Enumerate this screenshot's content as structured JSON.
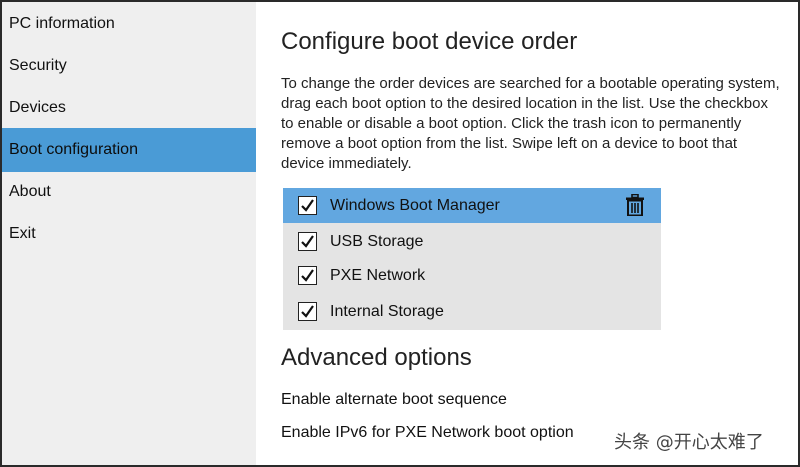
{
  "sidebar": {
    "items": [
      {
        "label": "PC information",
        "active": false
      },
      {
        "label": "Security",
        "active": false
      },
      {
        "label": "Devices",
        "active": false
      },
      {
        "label": "Boot configuration",
        "active": true
      },
      {
        "label": "About",
        "active": false
      },
      {
        "label": "Exit",
        "active": false
      }
    ]
  },
  "main": {
    "title": "Configure boot device order",
    "description": "To change the order devices are searched for a bootable operating system, drag each boot option to the desired location in the list. Use the checkbox to enable or disable a boot option. Click the trash icon to permanently remove a boot option from the list. Swipe left on a device to boot that device immediately.",
    "boot_devices": [
      {
        "label": "Windows Boot Manager",
        "checked": true,
        "selected": true
      },
      {
        "label": "USB Storage",
        "checked": true,
        "selected": false
      },
      {
        "label": "PXE Network",
        "checked": true,
        "selected": false
      },
      {
        "label": "Internal Storage",
        "checked": true,
        "selected": false
      }
    ],
    "advanced_title": "Advanced options",
    "advanced_options": [
      "Enable alternate boot sequence",
      "Enable IPv6 for PXE Network boot option"
    ]
  },
  "watermark": "头条 @开心太难了",
  "colors": {
    "sidebar_bg": "#efefef",
    "accent_active": "#4a9bd6",
    "selected_row": "#62a7e0",
    "list_bg": "#e4e4e4"
  },
  "icons": {
    "checkbox": "checkmark-icon",
    "delete": "trash-icon"
  }
}
